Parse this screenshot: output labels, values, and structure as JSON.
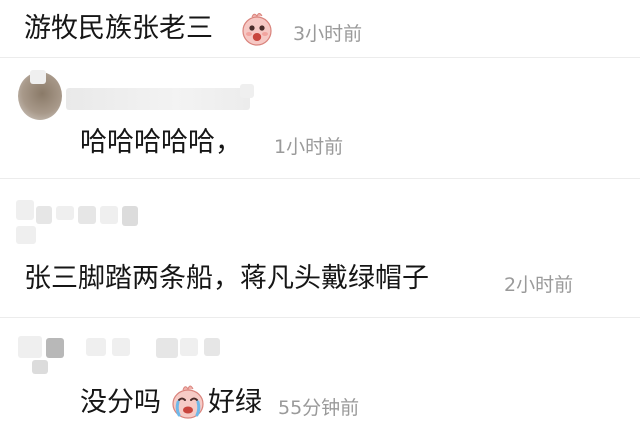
{
  "comments": [
    {
      "text": "游牧民族张老三",
      "emoji": "crying-face-icon",
      "time": "3小时前"
    },
    {
      "text": "哈哈哈哈哈，",
      "time": "1小时前"
    },
    {
      "text": "张三脚踏两条船，蒋凡头戴绿帽子",
      "time": "2小时前"
    },
    {
      "text": "没分吗",
      "emoji": "sobbing-face-icon",
      "text_after": "好绿",
      "time": "55分钟前"
    }
  ]
}
